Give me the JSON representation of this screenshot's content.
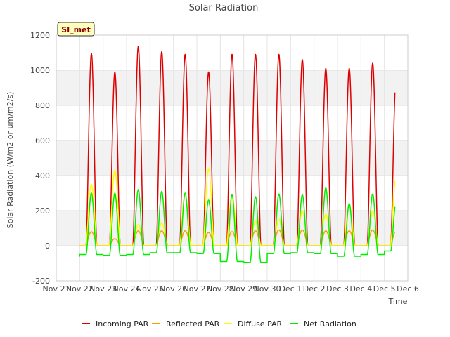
{
  "chart_data": {
    "type": "line",
    "title": "Solar Radiation",
    "xlabel": "Time",
    "ylabel": "Solar Radiation (W/m2 or um/m2/s)",
    "ylim": [
      -200,
      1200
    ],
    "yticks": [
      -200,
      0,
      200,
      400,
      600,
      800,
      1000,
      1200
    ],
    "xlim": [
      0,
      15
    ],
    "xtick_labels": [
      "Nov 21",
      "Nov 22",
      "Nov 23",
      "Nov 24",
      "Nov 25",
      "Nov 26",
      "Nov 27",
      "Nov 28",
      "Nov 29",
      "Nov 30",
      "Dec 1",
      "Dec 2",
      "Dec 3",
      "Dec 4",
      "Dec 5",
      "Dec 6"
    ],
    "x_unit": "days since Nov 21",
    "grid": true,
    "background_bands": true,
    "legend_position": "bottom",
    "badge": "SI_met",
    "day_peaks": {
      "days": [
        1,
        2,
        3,
        4,
        5,
        6,
        7,
        8,
        9,
        10,
        11,
        12,
        13,
        14
      ],
      "incoming": [
        1095,
        990,
        1135,
        1105,
        1090,
        990,
        1090,
        1090,
        1090,
        1060,
        1010,
        1010,
        1040,
        960
      ],
      "reflected": [
        80,
        40,
        85,
        85,
        85,
        75,
        80,
        85,
        90,
        90,
        85,
        85,
        90,
        85
      ],
      "diffuse": [
        350,
        430,
        120,
        130,
        290,
        440,
        290,
        140,
        150,
        200,
        180,
        230,
        200,
        400
      ],
      "net": [
        300,
        300,
        320,
        310,
        300,
        260,
        290,
        280,
        295,
        290,
        330,
        240,
        295,
        250
      ]
    },
    "night_net": [
      -60,
      -50,
      -55,
      -50,
      -40,
      -40,
      -45,
      -90,
      -95,
      -45,
      -40,
      -45,
      -60,
      -50,
      -30
    ],
    "series": [
      {
        "name": "Incoming PAR",
        "color": "#dd0000"
      },
      {
        "name": "Reflected PAR",
        "color": "#ff9900"
      },
      {
        "name": "Diffuse PAR",
        "color": "#ffff00"
      },
      {
        "name": "Net Radiation",
        "color": "#00ee00"
      }
    ]
  }
}
